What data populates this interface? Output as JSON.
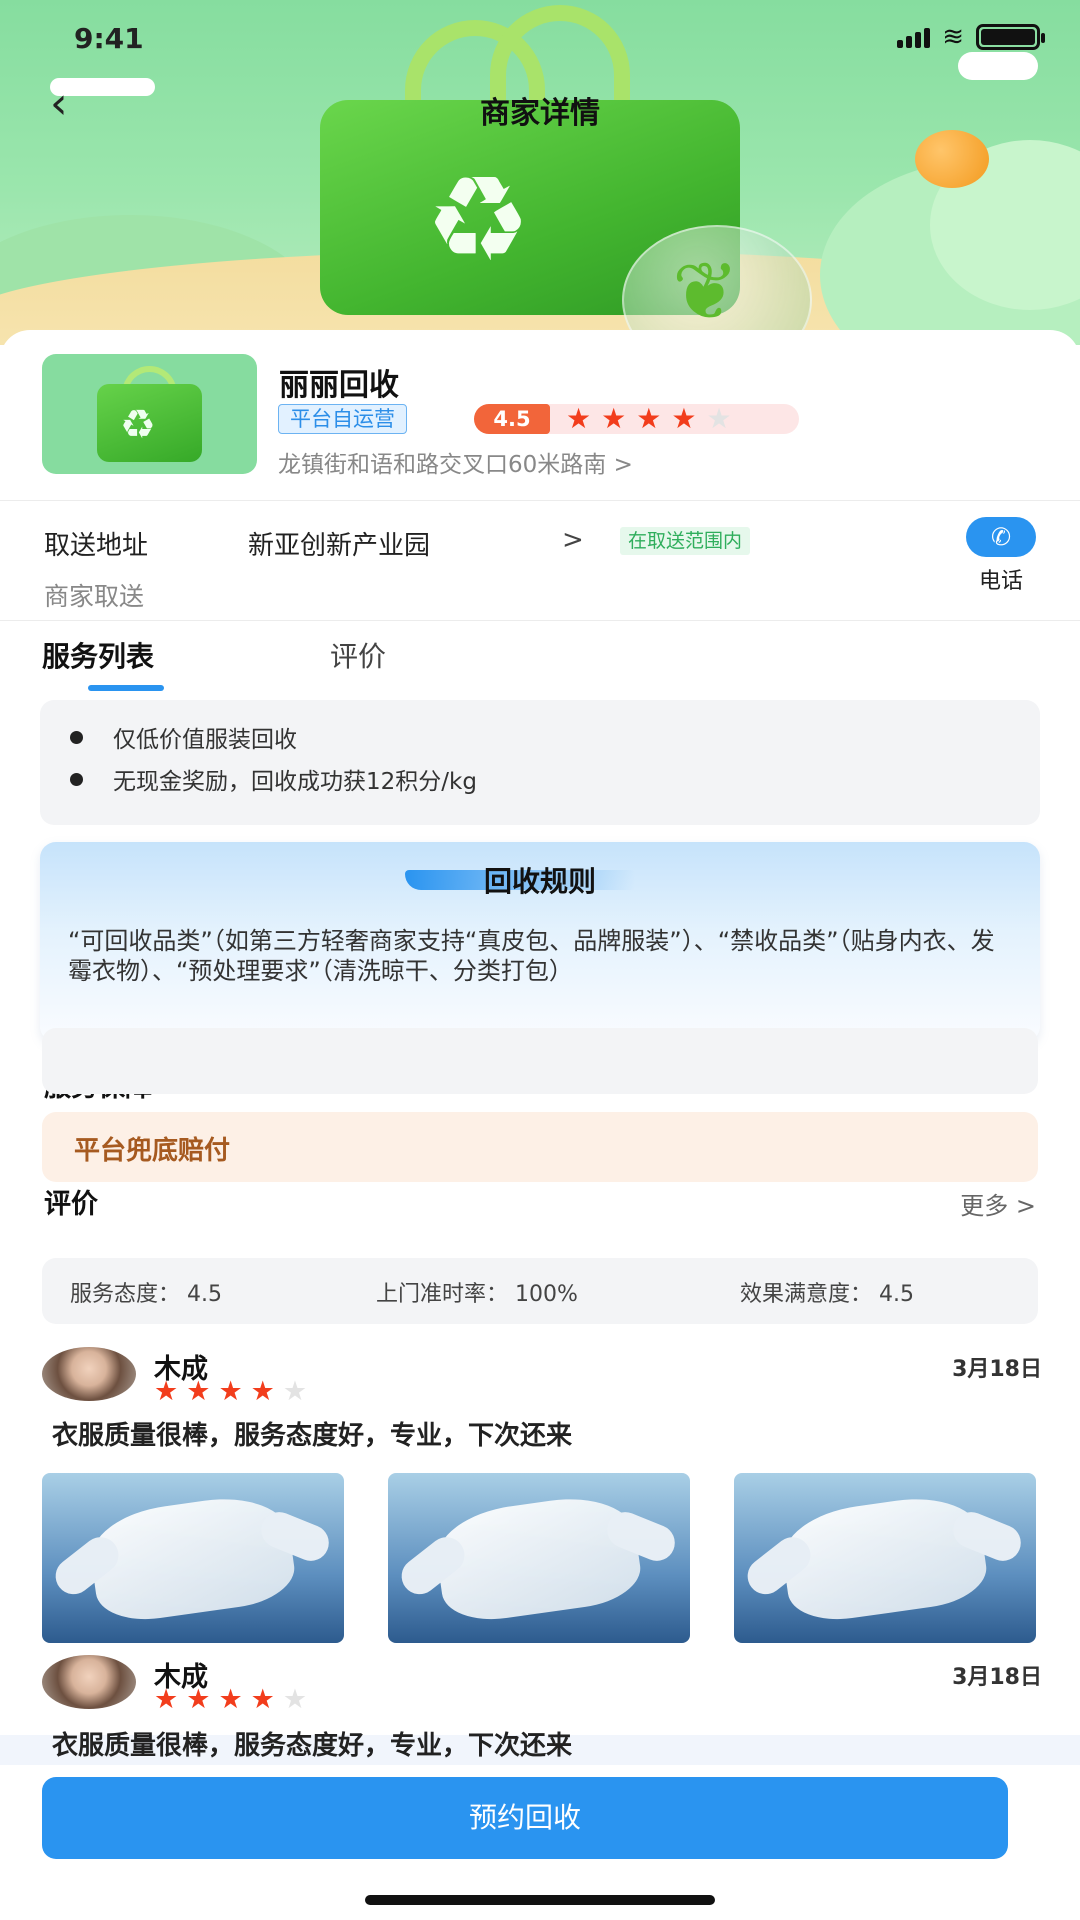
{
  "status_bar": {
    "time": "9:41"
  },
  "header": {
    "title": "商家详情"
  },
  "merchant": {
    "name": "丽丽回收",
    "tag": "平台自运营",
    "rating": "4.5",
    "stars": 4,
    "address": "龙镇街和语和路交叉口60米路南 >"
  },
  "pickup": {
    "label": "取送地址",
    "value": "新亚创新产业园",
    "arrow": ">",
    "badge": "在取送范围内",
    "sub": "商家取送",
    "phone_label": "电话"
  },
  "tabs": [
    {
      "label": "服务列表"
    },
    {
      "label": "评价"
    }
  ],
  "notes": [
    "仅低价值服装回收",
    "无现金奖励，回收成功获12积分/kg"
  ],
  "rules": {
    "title": "回收规则",
    "text": "“可回收品类”（如第三方轻奢商家支持“真皮包、品牌服装”）、“禁收品类”（贴身内衣、发霉衣物）、“预处理要求”（清洗晾干、分类打包）"
  },
  "guarantee": {
    "title": "服务保障",
    "item": "平台兜底赔付"
  },
  "reviews_section": {
    "title": "评价",
    "more": "更多  >",
    "metrics": [
      "服务态度：  4.5",
      "上门准时率：  100%",
      "效果满意度：  4.5"
    ]
  },
  "reviews": [
    {
      "name": "木成",
      "stars": 4,
      "date": "3月18日",
      "text": "衣服质量很棒，服务态度好，专业，下次还来",
      "photos": 3
    },
    {
      "name": "木成",
      "stars": 4,
      "date": "3月18日",
      "text": "衣服质量很棒，服务态度好，专业，下次还来",
      "photos": 0
    }
  ],
  "cta": {
    "label": "预约回收"
  },
  "colors": {
    "accent": "#2a94f0",
    "star": "#f23d1c",
    "rating_badge": "#f2653a",
    "guarantee_text": "#a65a20"
  },
  "icons": {
    "back": "chevron-left-icon",
    "phone": "phone-icon",
    "recycle": "recycle-icon"
  }
}
